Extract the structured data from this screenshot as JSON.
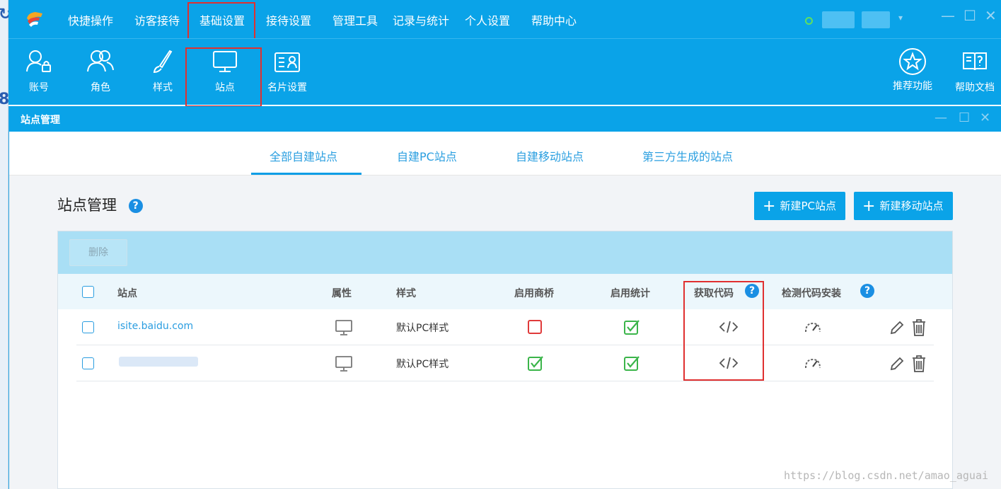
{
  "menubar": {
    "items": [
      "快捷操作",
      "访客接待",
      "基础设置",
      "接待设置",
      "管理工具",
      "记录与统计",
      "个人设置",
      "帮助中心"
    ]
  },
  "toolbar": {
    "left": [
      {
        "label": "账号",
        "icon": "account-icon"
      },
      {
        "label": "角色",
        "icon": "role-icon"
      },
      {
        "label": "样式",
        "icon": "brush-icon"
      },
      {
        "label": "站点",
        "icon": "monitor-icon"
      },
      {
        "label": "名片设置",
        "icon": "card-icon"
      }
    ],
    "right": [
      {
        "label": "推荐功能",
        "icon": "star-icon"
      },
      {
        "label": "帮助文档",
        "icon": "book-icon"
      }
    ]
  },
  "subwindow": {
    "title": "站点管理",
    "tabs": [
      "全部自建站点",
      "自建PC站点",
      "自建移动站点",
      "第三方生成的站点"
    ],
    "active_tab": "全部自建站点"
  },
  "panel": {
    "title": "站点管理",
    "help": "?",
    "btn_new_pc": "新建PC站点",
    "btn_new_mobile": "新建移动站点",
    "btn_delete": "删除"
  },
  "table": {
    "headers": {
      "site": "站点",
      "attr": "属性",
      "style": "样式",
      "bridge": "启用商桥",
      "stats": "启用统计",
      "code": "获取代码",
      "check": "检测代码安装"
    },
    "rows": [
      {
        "site": "isite.baidu.com",
        "style": "默认PC样式",
        "bridge": false,
        "stats": true
      },
      {
        "site": "",
        "style": "默认PC样式",
        "bridge": true,
        "stats": true
      }
    ]
  },
  "watermark": "https://blog.csdn.net/amao_aguai",
  "colors": {
    "brand": "#0aa3e8",
    "highlight": "#e03030",
    "check": "#3bb54a",
    "link": "#2a9de0"
  }
}
